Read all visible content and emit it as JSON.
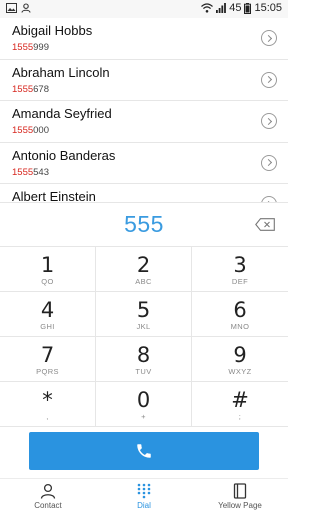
{
  "status_bar": {
    "signal_text": "45",
    "time": "15:05"
  },
  "contacts": [
    {
      "name": "Abigail Hobbs",
      "match": "1555",
      "rest": "999"
    },
    {
      "name": "Abraham Lincoln",
      "match": "1555",
      "rest": "678"
    },
    {
      "name": "Amanda Seyfried",
      "match": "1555",
      "rest": "000"
    },
    {
      "name": "Antonio Banderas",
      "match": "1555",
      "rest": "543"
    },
    {
      "name": "Albert Einstein",
      "match": "",
      "rest": ""
    }
  ],
  "dialer": {
    "number": "555"
  },
  "keypad": [
    {
      "digit": "1",
      "letters": "QO"
    },
    {
      "digit": "2",
      "letters": "ABC"
    },
    {
      "digit": "3",
      "letters": "DEF"
    },
    {
      "digit": "4",
      "letters": "GHI"
    },
    {
      "digit": "5",
      "letters": "JKL"
    },
    {
      "digit": "6",
      "letters": "MNO"
    },
    {
      "digit": "7",
      "letters": "PQRS"
    },
    {
      "digit": "8",
      "letters": "TUV"
    },
    {
      "digit": "9",
      "letters": "WXYZ"
    },
    {
      "digit": "*",
      "letters": ","
    },
    {
      "digit": "0",
      "letters": "+"
    },
    {
      "digit": "#",
      "letters": ";"
    }
  ],
  "nav": {
    "contact": "Contact",
    "dial": "Dial",
    "yellow_page": "Yellow Page"
  },
  "colors": {
    "accent": "#2a93e0",
    "match": "#d7261e"
  }
}
